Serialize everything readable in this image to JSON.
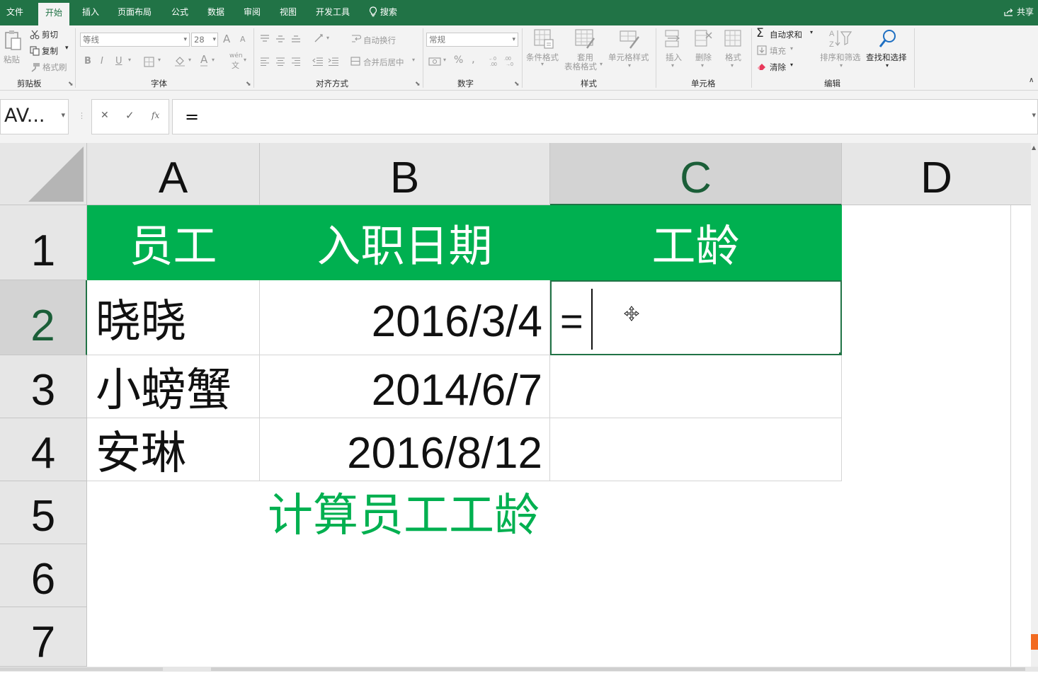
{
  "menu": {
    "tabs": [
      "文件",
      "开始",
      "插入",
      "页面布局",
      "公式",
      "数据",
      "审阅",
      "视图",
      "开发工具"
    ],
    "active_tab": "开始",
    "search": "搜索",
    "share": "共享"
  },
  "ribbon": {
    "clipboard": {
      "paste": "粘贴",
      "cut": "剪切",
      "copy": "复制",
      "format_painter": "格式刷",
      "label": "剪贴板"
    },
    "font": {
      "name": "等线",
      "size": "28",
      "grow": "A",
      "shrink": "A",
      "bold": "B",
      "italic": "I",
      "underline": "U",
      "color": "A",
      "phonetic": "wén",
      "label": "字体"
    },
    "alignment": {
      "wrap": "自动换行",
      "merge": "合并后居中",
      "label": "对齐方式"
    },
    "number": {
      "format": "常规",
      "percent": "%",
      "comma": ",",
      "label": "数字"
    },
    "styles": {
      "conditional": "条件格式",
      "table1": "套用",
      "table2": "表格格式",
      "cell_styles": "单元格样式",
      "label": "样式"
    },
    "cells": {
      "insert": "插入",
      "delete": "删除",
      "format": "格式",
      "label": "单元格"
    },
    "editing": {
      "autosum": "自动求和",
      "fill": "填充",
      "clear": "清除",
      "sort": "排序和筛选",
      "find": "查找和选择",
      "label": "编辑"
    }
  },
  "formula_bar": {
    "name_box": "AV...",
    "cancel": "✕",
    "enter": "✓",
    "fx": "fx",
    "content": "="
  },
  "columns": [
    "A",
    "B",
    "C",
    "D"
  ],
  "rows": [
    "1",
    "2",
    "3",
    "4",
    "5",
    "6",
    "7"
  ],
  "table": {
    "headers": [
      "员工",
      "入职日期",
      "工龄"
    ],
    "rows": [
      {
        "name": "晓晓",
        "date": "2016/3/4",
        "seniority": "="
      },
      {
        "name": "小螃蟹",
        "date": "2014/6/7",
        "seniority": ""
      },
      {
        "name": "安琳",
        "date": "2016/8/12",
        "seniority": ""
      }
    ]
  },
  "caption": "计算员工工龄",
  "colors": {
    "accent": "#217346",
    "header_fill": "#00b050",
    "caption": "#00b050"
  }
}
